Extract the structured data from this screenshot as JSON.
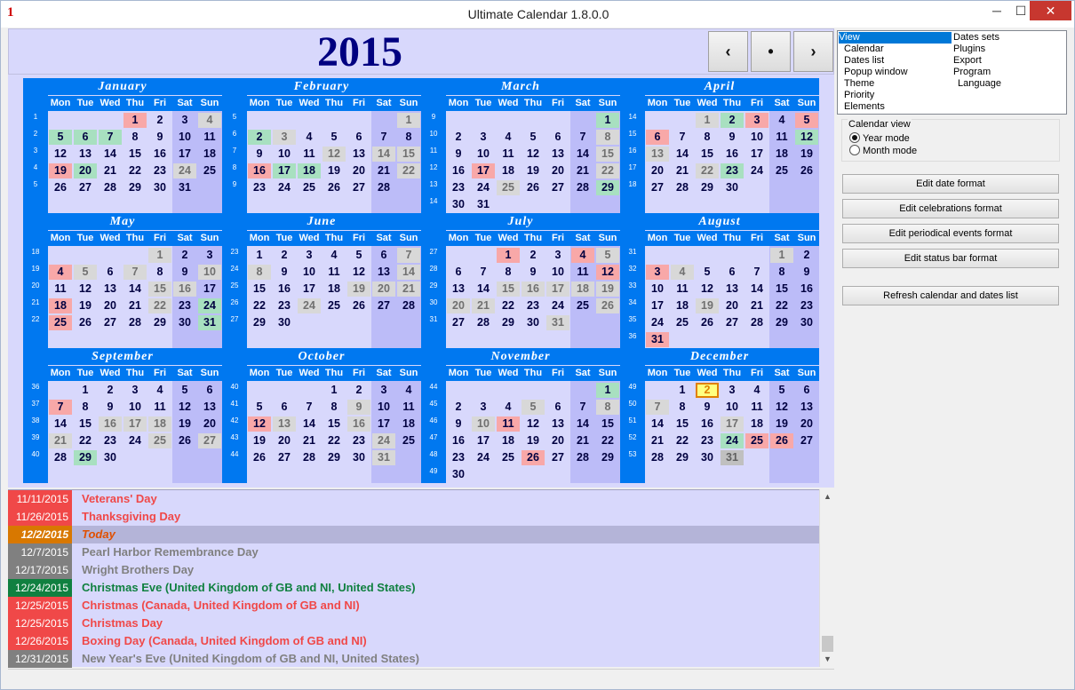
{
  "window": {
    "title": "Ultimate Calendar 1.8.0.0",
    "icon": "1",
    "min": "─",
    "max": "☐",
    "close": "✕"
  },
  "header": {
    "year": "2015",
    "prev": "‹",
    "today": "•",
    "next": "›"
  },
  "day_headers": [
    "Mon",
    "Tue",
    "Wed",
    "Thu",
    "Fri",
    "Sat",
    "Sun"
  ],
  "months": [
    {
      "name": "January",
      "start": 4,
      "days": 31,
      "weeks": [
        "1",
        "2",
        "3",
        "4",
        "5"
      ],
      "marks": {
        "1": "hol",
        "4": "gry",
        "5": "grn",
        "6": "grn",
        "7": "grn",
        "19": "hol",
        "20": "grn",
        "24": "gry"
      }
    },
    {
      "name": "February",
      "start": 7,
      "days": 28,
      "weeks": [
        "5",
        "6",
        "7",
        "8",
        "9"
      ],
      "marks": {
        "1": "gry",
        "2": "grn",
        "3": "gry",
        "12": "gry",
        "14": "gry",
        "15": "gry",
        "16": "hol",
        "17": "grn",
        "18": "grn",
        "22": "gry"
      }
    },
    {
      "name": "March",
      "start": 7,
      "days": 31,
      "weeks": [
        "9",
        "10",
        "11",
        "12",
        "13",
        "14"
      ],
      "marks": {
        "1": "grn",
        "8": "gry",
        "15": "gry",
        "17": "hol",
        "22": "gry",
        "25": "gry",
        "29": "grn"
      }
    },
    {
      "name": "April",
      "start": 3,
      "days": 30,
      "weeks": [
        "14",
        "15",
        "16",
        "17",
        "18"
      ],
      "marks": {
        "1": "gry",
        "2": "grn",
        "3": "hol",
        "5": "hol",
        "6": "hol",
        "12": "grn",
        "13": "gry",
        "22": "gry",
        "23": "grn"
      }
    },
    {
      "name": "May",
      "start": 5,
      "days": 31,
      "weeks": [
        "18",
        "19",
        "20",
        "21",
        "22"
      ],
      "marks": {
        "1": "gry",
        "4": "hol",
        "5": "gry",
        "7": "gry",
        "10": "gry",
        "15": "gry",
        "16": "gry",
        "18": "hol",
        "22": "gry",
        "24": "grn",
        "25": "hol",
        "31": "grn"
      }
    },
    {
      "name": "June",
      "start": 1,
      "days": 30,
      "weeks": [
        "23",
        "24",
        "25",
        "26",
        "27"
      ],
      "marks": {
        "7": "gry",
        "8": "gry",
        "14": "gry",
        "19": "gry",
        "20": "gry",
        "21": "gry",
        "24": "gry"
      }
    },
    {
      "name": "July",
      "start": 3,
      "days": 31,
      "weeks": [
        "27",
        "28",
        "29",
        "30",
        "31"
      ],
      "marks": {
        "1": "hol",
        "4": "hol",
        "5": "gry",
        "12": "hol",
        "15": "gry",
        "16": "gry",
        "17": "gry",
        "18": "gry",
        "19": "gry",
        "20": "gry",
        "21": "gry",
        "26": "gry",
        "31": "gry"
      }
    },
    {
      "name": "August",
      "start": 6,
      "days": 31,
      "weeks": [
        "31",
        "32",
        "33",
        "34",
        "35",
        "36"
      ],
      "marks": {
        "1": "gry",
        "3": "hol",
        "4": "gry",
        "19": "gry",
        "31": "hol"
      }
    },
    {
      "name": "September",
      "start": 2,
      "days": 30,
      "weeks": [
        "36",
        "37",
        "38",
        "39",
        "40"
      ],
      "marks": {
        "7": "hol",
        "16": "gry",
        "17": "gry",
        "18": "gry",
        "21": "gry",
        "25": "gry",
        "27": "gry",
        "29": "grn"
      }
    },
    {
      "name": "October",
      "start": 4,
      "days": 31,
      "weeks": [
        "40",
        "41",
        "42",
        "43",
        "44"
      ],
      "marks": {
        "9": "gry",
        "12": "hol",
        "13": "gry",
        "16": "gry",
        "24": "gry",
        "31": "gry"
      }
    },
    {
      "name": "November",
      "start": 7,
      "days": 30,
      "weeks": [
        "44",
        "45",
        "46",
        "47",
        "48",
        "49"
      ],
      "marks": {
        "1": "grn",
        "5": "gry",
        "8": "gry",
        "10": "gry",
        "11": "hol",
        "26": "hol"
      }
    },
    {
      "name": "December",
      "start": 2,
      "days": 31,
      "weeks": [
        "49",
        "50",
        "51",
        "52",
        "53"
      ],
      "marks": {
        "2": "today",
        "7": "gry",
        "17": "gry",
        "24": "grn",
        "25": "hol",
        "26": "hol",
        "31": "gryd"
      }
    }
  ],
  "events": [
    {
      "date": "11/11/2015",
      "name": "Veterans' Day",
      "date_bg": "#f04848",
      "color": "#f04848"
    },
    {
      "date": "11/26/2015",
      "name": "Thanksgiving Day",
      "date_bg": "#f04848",
      "color": "#f04848"
    },
    {
      "date": "12/2/2015",
      "name": "Today",
      "date_bg": "#d87800",
      "color": "#e05000",
      "today": true
    },
    {
      "date": "12/7/2015",
      "name": "Pearl Harbor Remembrance Day",
      "date_bg": "#808080",
      "color": "#808080"
    },
    {
      "date": "12/17/2015",
      "name": "Wright Brothers Day",
      "date_bg": "#808080",
      "color": "#808080"
    },
    {
      "date": "12/24/2015",
      "name": "Christmas Eve (United Kingdom of GB and NI, United States)",
      "date_bg": "#108040",
      "color": "#108040"
    },
    {
      "date": "12/25/2015",
      "name": "Christmas (Canada, United Kingdom of GB and NI)",
      "date_bg": "#f04848",
      "color": "#f04848"
    },
    {
      "date": "12/25/2015",
      "name": "Christmas Day",
      "date_bg": "#f04848",
      "color": "#f04848"
    },
    {
      "date": "12/26/2015",
      "name": "Boxing Day (Canada, United Kingdom of GB and NI)",
      "date_bg": "#f04848",
      "color": "#f04848"
    },
    {
      "date": "12/31/2015",
      "name": "New Year's Eve (United Kingdom of GB and NI, United States)",
      "date_bg": "#808080",
      "color": "#808080"
    }
  ],
  "tree": {
    "col1": [
      "View",
      "Calendar",
      "Dates list",
      "Popup window",
      "Theme",
      "Priority",
      "Elements"
    ],
    "col2": [
      "Dates sets",
      "Plugins",
      "Export",
      "Program",
      "Language"
    ]
  },
  "calendar_view": {
    "legend": "Calendar view",
    "year_mode": "Year mode",
    "month_mode": "Month mode"
  },
  "buttons": {
    "edit_date": "Edit date format",
    "edit_celebrations": "Edit celebrations format",
    "edit_periodical": "Edit periodical events format",
    "edit_status": "Edit status bar format",
    "refresh": "Refresh calendar and dates list"
  },
  "scroll": {
    "up": "▲",
    "down": "▼"
  },
  "colors": {
    "month_header": "#0078f0",
    "panel_bg": "#d8d8fc",
    "weekend_bg": "#bcbcf8",
    "year_text": "#000080"
  }
}
